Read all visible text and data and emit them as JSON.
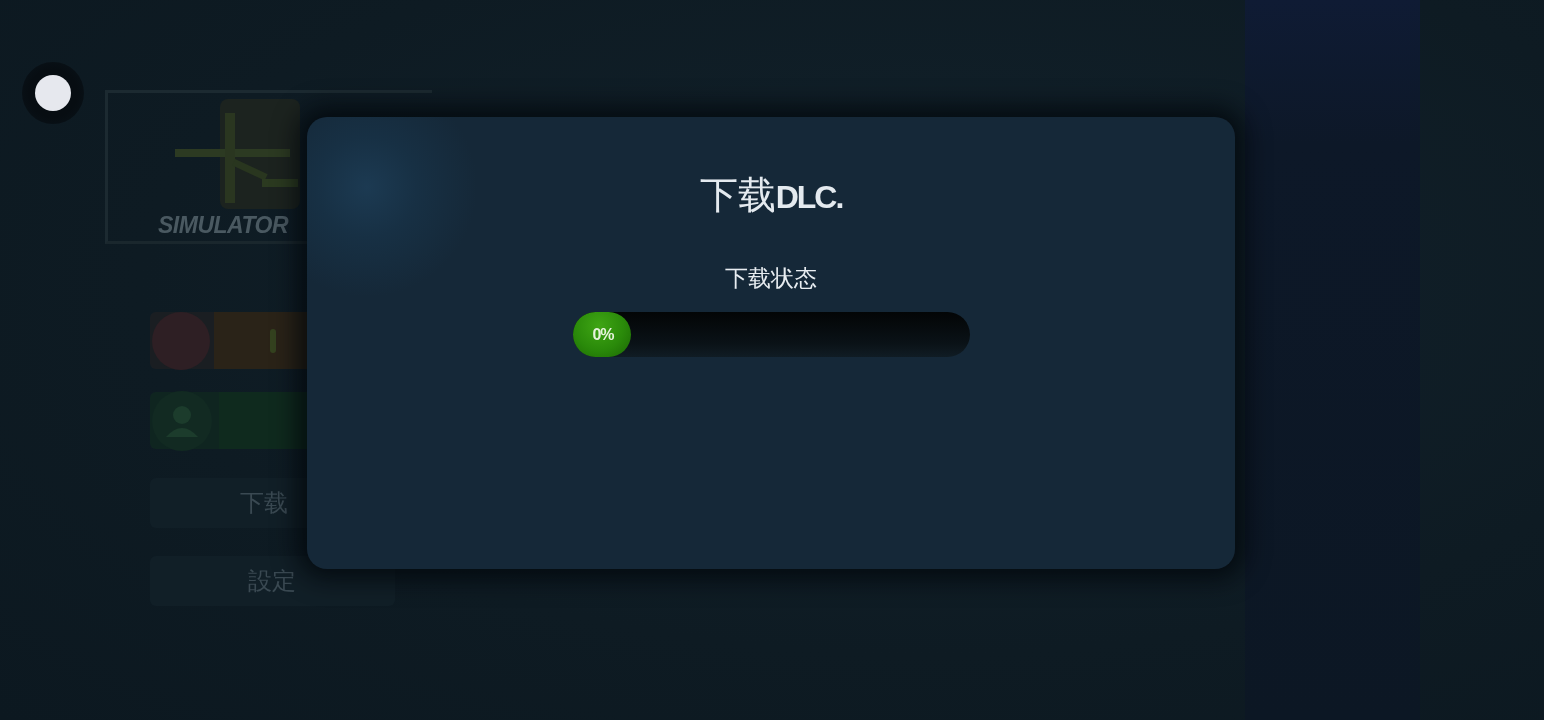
{
  "background_menu": {
    "logo": {
      "text": "SIMULATOR"
    },
    "buttons": [
      {
        "kind": "profile"
      },
      {
        "kind": "social"
      },
      {
        "kind": "text",
        "label": "下载"
      },
      {
        "kind": "text",
        "label": "設定"
      }
    ]
  },
  "dialog": {
    "title": "下载**DLC.**",
    "status_label": "下载状态",
    "progress": {
      "level": 0,
      "reading": "0%"
    }
  }
}
